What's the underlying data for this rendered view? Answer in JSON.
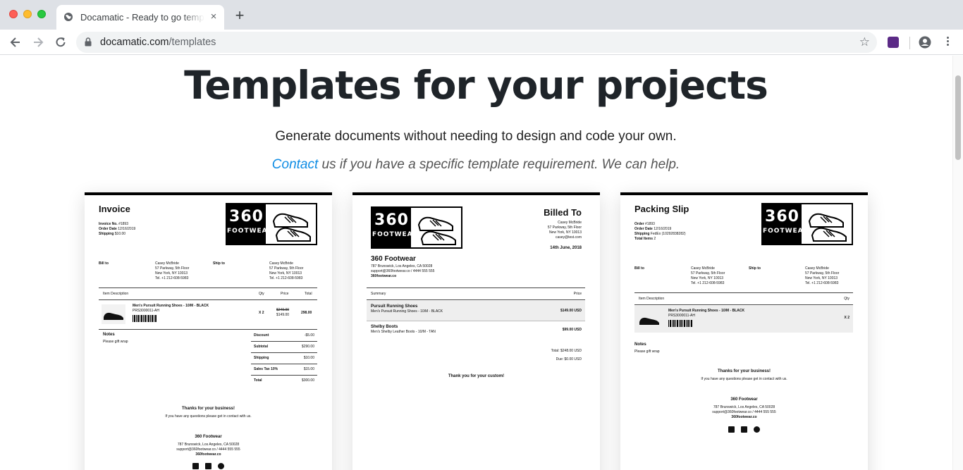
{
  "browser": {
    "tab_title": "Docamatic - Ready to go templates",
    "tab_close": "×",
    "new_tab": "+",
    "url_domain": "docamatic.com",
    "url_path": "/templates"
  },
  "page": {
    "heading": "Templates for your projects",
    "subheading": "Generate documents without needing to design and code your own.",
    "contact_link": "Contact",
    "contact_rest": " us if you have a specific template requirement. We can help."
  },
  "logo": {
    "number": "360",
    "word": "FOOTWEAR"
  },
  "invoice": {
    "title": "Invoice",
    "meta": [
      {
        "label": "Invoice No.",
        "value": "#1893"
      },
      {
        "label": "Order Date",
        "value": "12/16/2019"
      },
      {
        "label": "Shipping",
        "value": "$10.00"
      }
    ],
    "bill_to_label": "Bill to",
    "ship_to_label": "Ship to",
    "address_lines": [
      "Casey McBride",
      "57 Parkway, 5th Floor",
      "New York, NY 10013",
      "Tel. +1 212-608-5983"
    ],
    "columns": [
      "Item Description",
      "Qty",
      "Price",
      "Total"
    ],
    "item_name": "Men's Pursuit Running Shoes - 10/M - BLACK",
    "item_sku": "PRS3000011-AH",
    "item_qty": "X 2",
    "item_old_price": "$249.00",
    "item_price": "$149.00",
    "item_total": "298.00",
    "notes_label": "Notes",
    "notes_text": "Please gift wrap",
    "totals": [
      {
        "label": "Discount",
        "value": "-$5.00"
      },
      {
        "label": "Subtotal",
        "value": "$290.00"
      },
      {
        "label": "Shipping",
        "value": "$10.00"
      },
      {
        "label": "Sales Tax 10%",
        "value": "$15.00"
      },
      {
        "label": "Total",
        "value": "$300.00"
      }
    ],
    "thanks": "Thanks for your business!",
    "questions": "If you have any questions please get in contact with us.",
    "company": "360 Footwear",
    "company_address": "787 Brunswick, Los Angeles, CA 50028",
    "company_contact": "support@360footwear.co / 4444 555 555",
    "company_site": "360footwear.co"
  },
  "receipt": {
    "billed_to": "Billed To",
    "billed_lines": [
      "Casey McBride",
      "57 Parkway, 5th Floor",
      "New York, NY 10013",
      "casey@test.com"
    ],
    "date": "14th June, 2018",
    "company": "360 Footwear",
    "company_address": "787 Brunswick, Los Angeles, CA 50028",
    "company_contact": "support@360footwear.co / 4444 555 555",
    "company_site": "360footwear.co",
    "col_summary": "Summary",
    "col_price": "Price",
    "items": [
      {
        "name": "Pursuit Running Shoes",
        "desc": "Men's Pursuit Running Shoes - 10/M - BLACK",
        "price": "$149.00 USD"
      },
      {
        "name": "Shelby Boots",
        "desc": "Men's Shelby Leather Boots - 10/M - TAN",
        "price": "$99.00 USD"
      }
    ],
    "total": "Total: $248.00 USD",
    "due": "Due: $0.00 USD",
    "thanks": "Thank you for your custom!"
  },
  "packing": {
    "title": "Packing Slip",
    "meta": [
      {
        "label": "Order",
        "value": "#1893"
      },
      {
        "label": "Order Date",
        "value": "12/16/2019"
      },
      {
        "label": "Shipping",
        "value": "FedEx (10292838282)"
      },
      {
        "label": "Total Items",
        "value": "2"
      }
    ],
    "bill_to_label": "Bill to",
    "ship_to_label": "Ship to",
    "address_lines": [
      "Casey McBride",
      "57 Parkway, 5th Floor",
      "New York, NY 10013",
      "Tel. +1 212-608-5983"
    ],
    "col_item": "Item Description",
    "col_qty": "Qty",
    "item_name": "Men's Pursuit Running Shoes - 10/M - BLACK",
    "item_sku": "PRS3000011-AH",
    "item_qty": "X 2",
    "notes_label": "Notes",
    "notes_text": "Please gift wrap",
    "thanks": "Thanks for your business!",
    "questions": "If you have any questions please get in contact with us.",
    "company": "360 Footwear",
    "company_address": "787 Brunswick, Los Angeles, CA 50028",
    "company_contact": "support@360footwear.co / 4444 555 555",
    "company_site": "360footwear.co"
  }
}
